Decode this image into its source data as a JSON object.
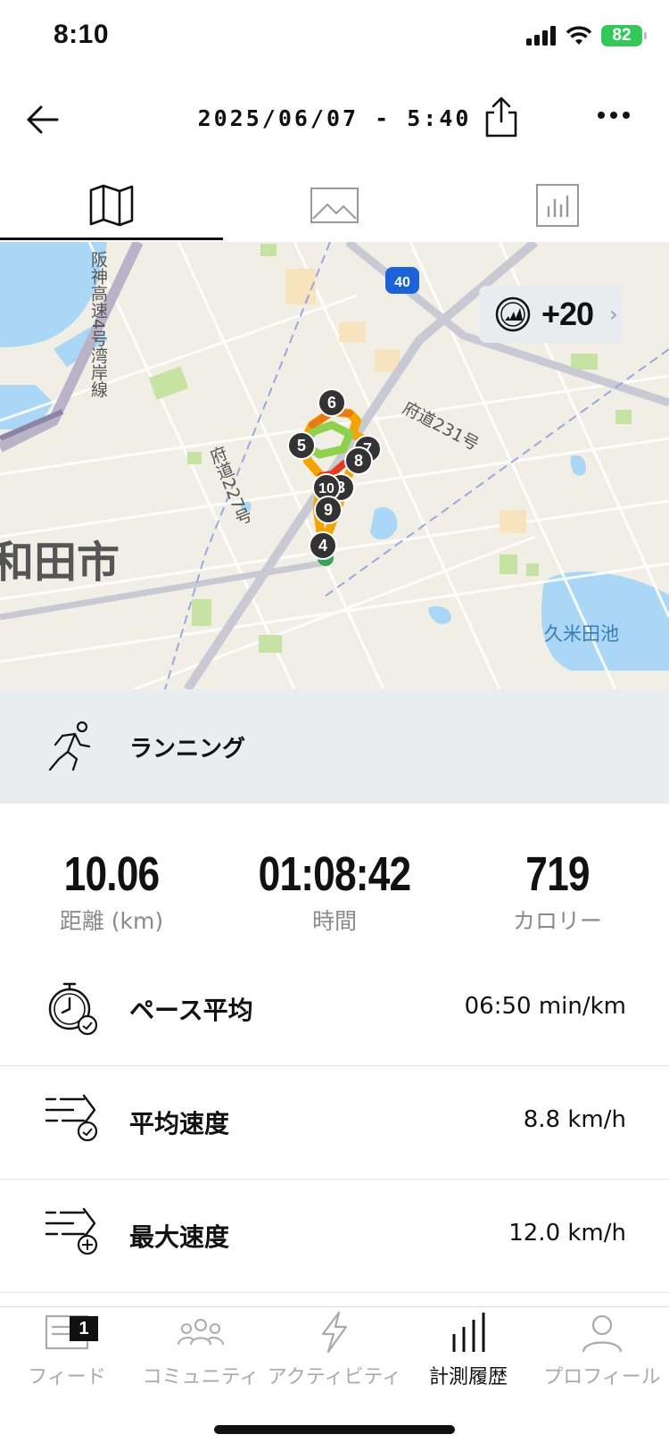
{
  "status": {
    "time": "8:10",
    "battery": "82"
  },
  "header": {
    "title": "2025/06/07 - 5:40"
  },
  "tabs": [
    {
      "name": "map"
    },
    {
      "name": "photos"
    },
    {
      "name": "stats"
    }
  ],
  "map": {
    "labels": {
      "expressway": "阪神高速4号湾岸線",
      "route40": "40",
      "route231": "府道231号",
      "route227": "府道227号",
      "city": "和田市",
      "pond": "久米田池"
    },
    "markers": [
      "6",
      "5",
      "7",
      "8",
      "10",
      "3",
      "9",
      "4"
    ],
    "points_badge": "+20"
  },
  "activity": {
    "type": "ランニング"
  },
  "stats": [
    {
      "value": "10.06",
      "label": "距離 (km)"
    },
    {
      "value": "01:08:42",
      "label": "時間"
    },
    {
      "value": "719",
      "label": "カロリー"
    }
  ],
  "metrics": [
    {
      "label": "ペース平均",
      "value": "06:50 min/km"
    },
    {
      "label": "平均速度",
      "value": "8.8 km/h"
    },
    {
      "label": "最大速度",
      "value": "12.0 km/h"
    }
  ],
  "nav": {
    "items": [
      {
        "label": "フィード",
        "badge": "1"
      },
      {
        "label": "コミュニティ"
      },
      {
        "label": "アクティビティ"
      },
      {
        "label": "計測履歴"
      },
      {
        "label": "プロフィール"
      }
    ],
    "active": "計測履歴"
  },
  "colors": {
    "route_hot": "#e53a1f",
    "route_warm": "#f5a300",
    "route_cool": "#8fd14f",
    "start": "#3aa35b",
    "water": "#a9d7f5"
  }
}
